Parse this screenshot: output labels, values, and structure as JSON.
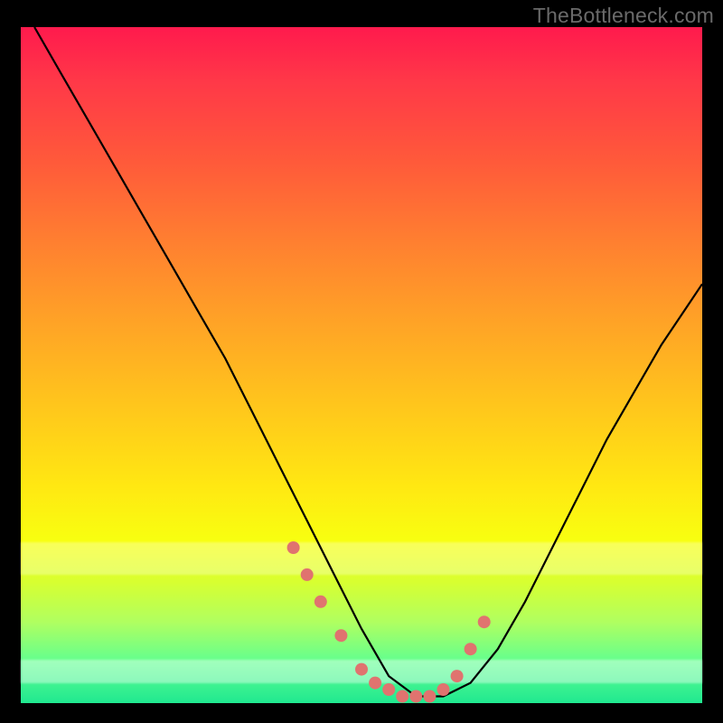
{
  "watermark": "TheBottleneck.com",
  "chart_data": {
    "type": "line",
    "title": "",
    "xlabel": "",
    "ylabel": "",
    "xlim": [
      0,
      100
    ],
    "ylim": [
      0,
      100
    ],
    "grid": false,
    "legend": false,
    "series": [
      {
        "name": "bottleneck-curve",
        "x": [
          2,
          6,
          10,
          14,
          18,
          22,
          26,
          30,
          34,
          38,
          42,
          46,
          50,
          54,
          58,
          62,
          66,
          70,
          74,
          78,
          82,
          86,
          90,
          94,
          98,
          100
        ],
        "values": [
          100,
          93,
          86,
          79,
          72,
          65,
          58,
          51,
          43,
          35,
          27,
          19,
          11,
          4,
          1,
          1,
          3,
          8,
          15,
          23,
          31,
          39,
          46,
          53,
          59,
          62
        ]
      }
    ],
    "markers": {
      "name": "highlight-points",
      "x": [
        40,
        42,
        44,
        47,
        50,
        52,
        54,
        56,
        58,
        60,
        62,
        64,
        66,
        68
      ],
      "values": [
        23,
        19,
        15,
        10,
        5,
        3,
        2,
        1,
        1,
        1,
        2,
        4,
        8,
        12
      ],
      "color": "#e0736f"
    },
    "background_gradient": {
      "top": "#ff1a4d",
      "bottom": "#20e890"
    }
  }
}
